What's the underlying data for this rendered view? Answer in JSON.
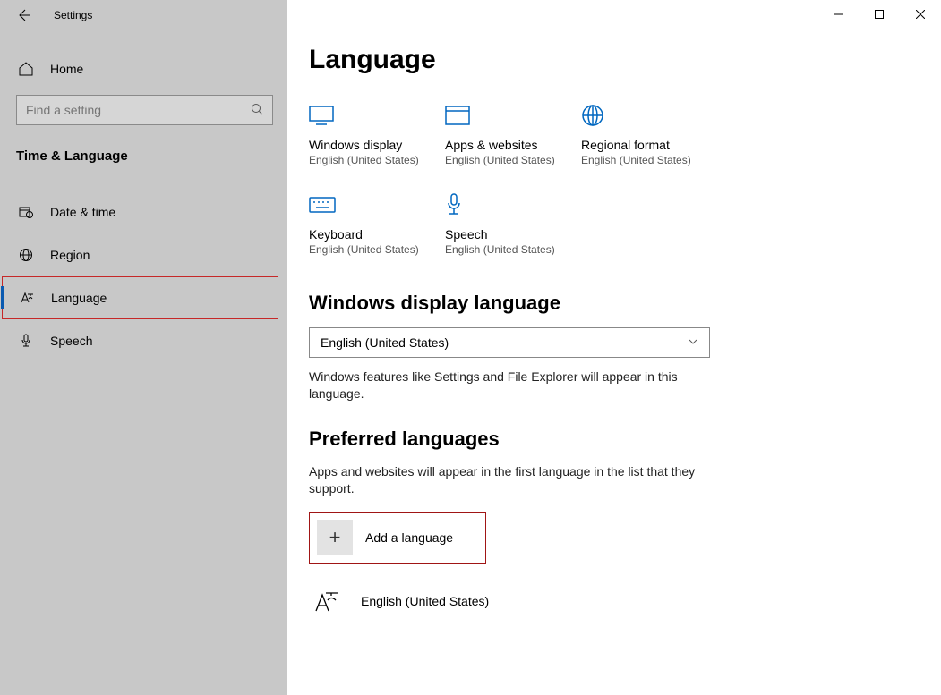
{
  "window": {
    "title": "Settings"
  },
  "sidebar": {
    "home": "Home",
    "search_placeholder": "Find a setting",
    "category": "Time & Language",
    "items": [
      {
        "label": "Date & time"
      },
      {
        "label": "Region"
      },
      {
        "label": "Language"
      },
      {
        "label": "Speech"
      }
    ]
  },
  "page": {
    "title": "Language",
    "tiles": [
      {
        "title": "Windows display",
        "sub": "English (United States)"
      },
      {
        "title": "Apps & websites",
        "sub": "English (United States)"
      },
      {
        "title": "Regional format",
        "sub": "English (United States)"
      },
      {
        "title": "Keyboard",
        "sub": "English (United States)"
      },
      {
        "title": "Speech",
        "sub": "English (United States)"
      }
    ],
    "display_section": {
      "heading": "Windows display language",
      "selected": "English (United States)",
      "desc": "Windows features like Settings and File Explorer will appear in this language."
    },
    "preferred": {
      "heading": "Preferred languages",
      "desc": "Apps and websites will appear in the first language in the list that they support.",
      "add_label": "Add a language",
      "items": [
        "English (United States)"
      ]
    }
  }
}
